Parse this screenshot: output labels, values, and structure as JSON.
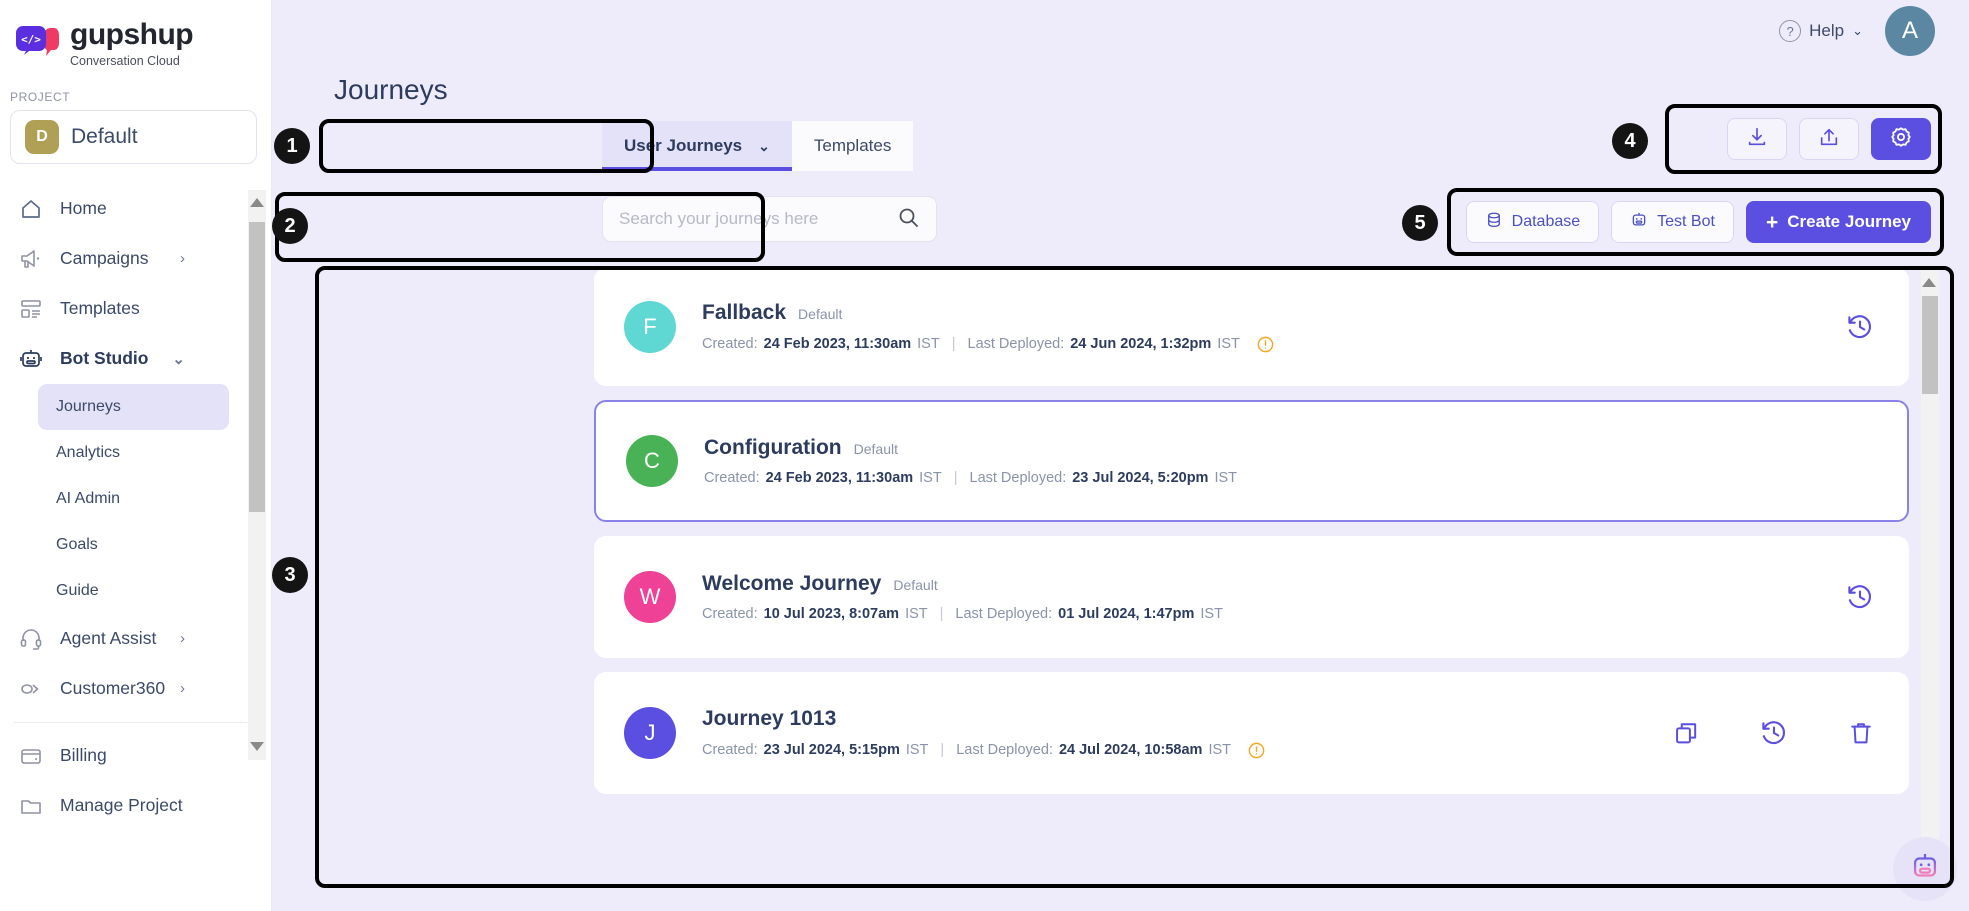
{
  "brand": {
    "name": "gupshup",
    "tagline": "Conversation Cloud",
    "logo_icon": "code-bubble-logo-icon"
  },
  "sidebar": {
    "project_label": "PROJECT",
    "project": {
      "initial": "D",
      "name": "Default"
    },
    "items": [
      {
        "label": "Home",
        "icon": "home-icon",
        "expandable": false
      },
      {
        "label": "Campaigns",
        "icon": "megaphone-icon",
        "expandable": true
      },
      {
        "label": "Templates",
        "icon": "templates-icon",
        "expandable": false
      },
      {
        "label": "Bot Studio",
        "icon": "robot-icon",
        "expandable": true
      }
    ],
    "sub_items": [
      {
        "label": "Journeys",
        "active": true
      },
      {
        "label": "Analytics",
        "active": false
      },
      {
        "label": "AI Admin",
        "active": false
      },
      {
        "label": "Goals",
        "active": false
      },
      {
        "label": "Guide",
        "active": false
      }
    ],
    "items_lower": [
      {
        "label": "Agent Assist",
        "icon": "headset-icon",
        "expandable": true
      },
      {
        "label": "Customer360",
        "icon": "customer360-icon",
        "expandable": true
      }
    ],
    "items_footer": [
      {
        "label": "Billing",
        "icon": "wallet-icon",
        "expandable": false
      },
      {
        "label": "Manage Project",
        "icon": "folder-icon",
        "expandable": false
      }
    ]
  },
  "topbar": {
    "help_label": "Help",
    "help_icon": "question-circle-icon",
    "avatar_initial": "A"
  },
  "page": {
    "title": "Journeys"
  },
  "tabs": [
    {
      "label": "User Journeys",
      "active": true,
      "has_chevron": true
    },
    {
      "label": "Templates",
      "active": false,
      "has_chevron": false
    }
  ],
  "search": {
    "placeholder": "Search your journeys here",
    "value": "",
    "icon": "search-icon"
  },
  "icon_toolbar": [
    {
      "name": "download-button",
      "icon": "download-icon",
      "primary": false
    },
    {
      "name": "export-button",
      "icon": "upload-icon",
      "primary": false
    },
    {
      "name": "settings-button",
      "icon": "gear-icon",
      "primary": true
    }
  ],
  "action_toolbar": {
    "database_label": "Database",
    "database_icon": "database-icon",
    "test_bot_label": "Test Bot",
    "test_bot_icon": "robot-icon",
    "create_label": "Create Journey",
    "create_icon": "plus-icon"
  },
  "journeys": [
    {
      "initial": "F",
      "avatar_color": "#5fd8d4",
      "title": "Fallback",
      "badge": "Default",
      "created_label": "Created:",
      "created_value": "24 Feb 2023, 11:30am",
      "created_tz": "IST",
      "deployed_label": "Last Deployed:",
      "deployed_value": "24 Jun 2024, 1:32pm",
      "deployed_tz": "IST",
      "warning": true,
      "selected": false,
      "actions": [
        "history-icon"
      ]
    },
    {
      "initial": "C",
      "avatar_color": "#49b257",
      "title": "Configuration",
      "badge": "Default",
      "created_label": "Created:",
      "created_value": "24 Feb 2023, 11:30am",
      "created_tz": "IST",
      "deployed_label": "Last Deployed:",
      "deployed_value": "23 Jul 2024, 5:20pm",
      "deployed_tz": "IST",
      "warning": false,
      "selected": true,
      "actions": []
    },
    {
      "initial": "W",
      "avatar_color": "#ef4196",
      "title": "Welcome Journey",
      "badge": "Default",
      "created_label": "Created:",
      "created_value": "10 Jul 2023, 8:07am",
      "created_tz": "IST",
      "deployed_label": "Last Deployed:",
      "deployed_value": "01 Jul 2024, 1:47pm",
      "deployed_tz": "IST",
      "warning": false,
      "selected": false,
      "actions": [
        "history-icon"
      ]
    },
    {
      "initial": "J",
      "avatar_color": "#5a4fe0",
      "title": "Journey 1013",
      "badge": "",
      "created_label": "Created:",
      "created_value": "23 Jul 2024, 5:15pm",
      "created_tz": "IST",
      "deployed_label": "Last Deployed:",
      "deployed_value": "24 Jul 2024, 10:58am",
      "deployed_tz": "IST",
      "warning": true,
      "selected": false,
      "actions": [
        "copy-icon",
        "history-icon",
        "trash-icon"
      ]
    }
  ],
  "annotations": [
    {
      "number": "1"
    },
    {
      "number": "2"
    },
    {
      "number": "3"
    },
    {
      "number": "4"
    },
    {
      "number": "5"
    }
  ],
  "fab": {
    "icon": "bot-assistant-icon"
  },
  "colors": {
    "accent": "#5a4fe0",
    "accent_soft": "#e4e2f8",
    "bg": "#eeecfb",
    "text": "#2d3c5e",
    "muted": "#8a93a8",
    "warning": "#f5a623"
  }
}
